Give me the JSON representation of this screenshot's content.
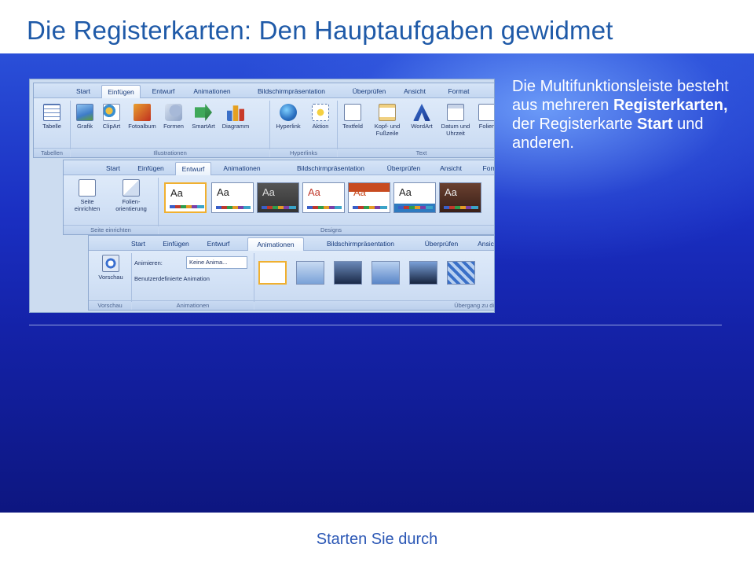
{
  "slide": {
    "title": "Die Registerkarten: Den Hauptaufgaben gewidmet",
    "footer": "Starten Sie durch",
    "body_text": {
      "part1": "Die Multifunktionsleiste besteht aus mehreren ",
      "bold1": "Registerkarten,",
      "part2": " der Registerkarte ",
      "bold2": "Start",
      "part3": " und anderen."
    }
  },
  "ribbon_insert": {
    "tabs": [
      "Start",
      "Einfügen",
      "Entwurf",
      "Animationen",
      "Bildschirmpräsentation",
      "Überprüfen",
      "Ansicht",
      "Format"
    ],
    "commands": [
      "Tabelle",
      "Grafik",
      "ClipArt",
      "Fotoalbum",
      "Formen",
      "SmartArt",
      "Diagramm",
      "Hyperlink",
      "Aktion",
      "Textfeld",
      "Kopf- und Fußzeile",
      "WordArt",
      "Datum und Uhrzeit",
      "Folien"
    ],
    "groups": [
      "Tabellen",
      "Illustrationen",
      "Hyperlinks",
      "Text"
    ]
  },
  "ribbon_design": {
    "tabs": [
      "Start",
      "Einfügen",
      "Entwurf",
      "Animationen",
      "Bildschirmpräsentation",
      "Überprüfen",
      "Ansicht",
      "Format"
    ],
    "commands": [
      "Seite einrichten",
      "Folien- orientierung"
    ],
    "themes": [
      "Aa",
      "Aa",
      "Aa",
      "Aa",
      "Aa",
      "Aa",
      "Aa"
    ],
    "groups": [
      "Seite einrichten",
      "Designs"
    ]
  },
  "ribbon_anim": {
    "tabs": [
      "Start",
      "Einfügen",
      "Entwurf",
      "Animationen",
      "Bildschirmpräsentation",
      "Überprüfen",
      "Ansicht"
    ],
    "commands": {
      "vorschau": "Vorschau",
      "animieren_label": "Animieren:",
      "animieren_value": "Keine Anima...",
      "custom": "Benutzerdefinierte Animation"
    },
    "groups": [
      "Vorschau",
      "Animationen",
      "Übergang zu dies"
    ]
  },
  "colors": {
    "title": "#1f5aa8",
    "footer": "#2b57b5",
    "background_top": "#2a4fd8",
    "background_bottom": "#0d1680"
  }
}
